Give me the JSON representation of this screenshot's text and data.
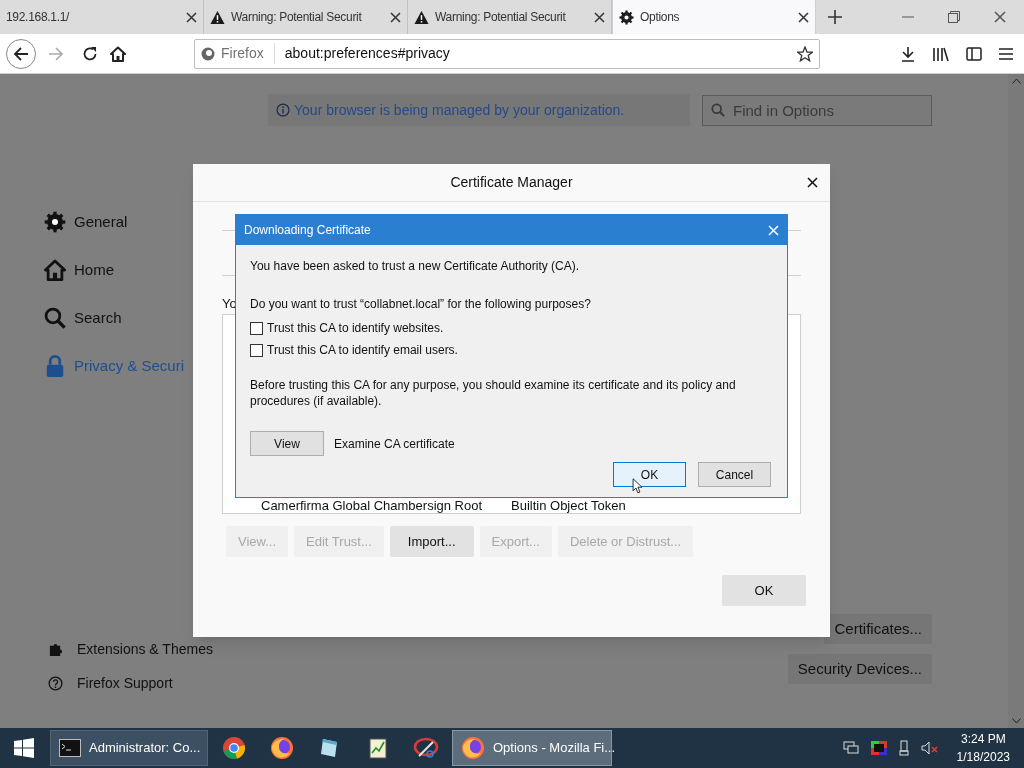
{
  "tabs": [
    {
      "label": "192.168.1.1/",
      "selected": false
    },
    {
      "label": "Warning: Potential Securit",
      "selected": false
    },
    {
      "label": "Warning: Potential Securit",
      "selected": false
    },
    {
      "label": "Options",
      "selected": true
    }
  ],
  "address_bar": {
    "identity": "Firefox",
    "url": "about:preferences#privacy"
  },
  "notice": "Your browser is being managed by your organization.",
  "search": {
    "placeholder": "Find in Options"
  },
  "sidebar": {
    "items": [
      {
        "label": "General",
        "selected": false
      },
      {
        "label": "Home",
        "selected": false
      },
      {
        "label": "Search",
        "selected": false
      },
      {
        "label": "Privacy & Securi",
        "selected": true
      }
    ],
    "footer": [
      "Extensions & Themes",
      "Firefox Support"
    ]
  },
  "page_buttons": [
    "Certificates...",
    "Security Devices..."
  ],
  "certificate_manager": {
    "title": "Certificate Manager",
    "intro": "Yo",
    "row": {
      "column_1": "Camerfirma Global Chambersign Root",
      "column_2": "Builtin Object Token"
    },
    "buttons": [
      {
        "label": "View...",
        "disabled": true
      },
      {
        "label": "Edit Trust...",
        "disabled": true
      },
      {
        "label": "Import...",
        "disabled": false
      },
      {
        "label": "Export...",
        "disabled": true
      },
      {
        "label": "Delete or Distrust...",
        "disabled": true
      }
    ],
    "ok": "OK"
  },
  "download_dialog": {
    "title": "Downloading Certificate",
    "message": "You have been asked to trust a new Certificate Authority (CA).",
    "question": "Do you want to trust “collabnet.local” for the following purposes?",
    "options": [
      {
        "label": "Trust this CA to identify websites.",
        "checked": false
      },
      {
        "label": "Trust this CA to identify email users.",
        "checked": false
      }
    ],
    "note": "Before trusting this CA for any purpose, you should examine its certificate and its policy and procedures (if available).",
    "view_button": "View",
    "view_label": "Examine CA certificate",
    "buttons": [
      {
        "label": "OK",
        "selected": true
      },
      {
        "label": "Cancel",
        "selected": false
      }
    ]
  },
  "taskbar": {
    "items": [
      {
        "kind": "window",
        "label": "Administrator: Co...",
        "selected": false
      },
      {
        "kind": "pinned"
      },
      {
        "kind": "pinned"
      },
      {
        "kind": "pinned"
      },
      {
        "kind": "pinned"
      },
      {
        "kind": "pinned"
      },
      {
        "kind": "window",
        "label": "Options - Mozilla Fi...",
        "selected": true
      }
    ],
    "time": "3:24 PM",
    "date": "1/18/2023"
  }
}
